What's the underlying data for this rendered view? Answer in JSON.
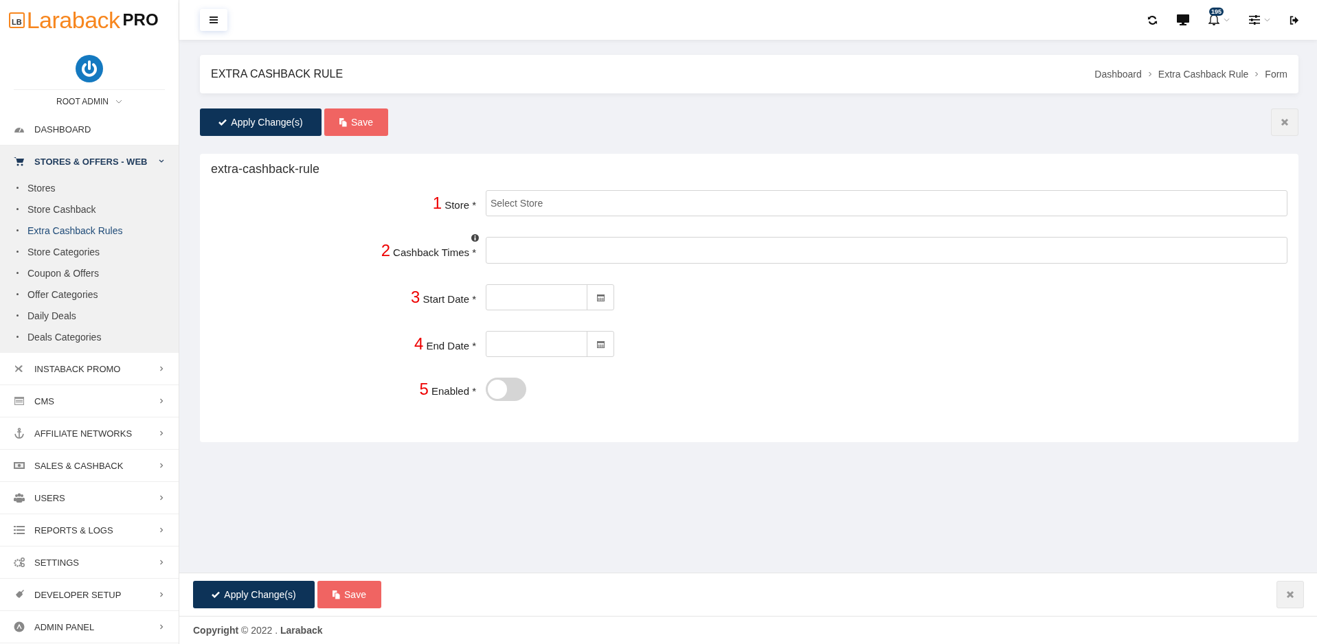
{
  "logo": {
    "mark": "LB",
    "name": "Laraback",
    "suffix": "PRO"
  },
  "user": {
    "name": "ROOT ADMIN"
  },
  "sidebar": {
    "items": [
      {
        "label": "DASHBOARD",
        "kind": "link",
        "expanded": false
      },
      {
        "label": "STORES & OFFERS - WEB",
        "kind": "group",
        "expanded": true,
        "children": [
          {
            "label": "Stores",
            "selected": false
          },
          {
            "label": "Store Cashback",
            "selected": false
          },
          {
            "label": "Extra Cashback Rules",
            "selected": true
          },
          {
            "label": "Store Categories",
            "selected": false
          },
          {
            "label": "Coupon & Offers",
            "selected": false
          },
          {
            "label": "Offer Categories",
            "selected": false
          },
          {
            "label": "Daily Deals",
            "selected": false
          },
          {
            "label": "Deals Categories",
            "selected": false
          }
        ]
      },
      {
        "label": "INSTABACK PROMO",
        "kind": "group",
        "expanded": false
      },
      {
        "label": "CMS",
        "kind": "group",
        "expanded": false
      },
      {
        "label": "AFFILIATE NETWORKS",
        "kind": "group",
        "expanded": false
      },
      {
        "label": "SALES & CASHBACK",
        "kind": "group",
        "expanded": false
      },
      {
        "label": "USERS",
        "kind": "group",
        "expanded": false
      },
      {
        "label": "REPORTS & LOGS",
        "kind": "group",
        "expanded": false
      },
      {
        "label": "SETTINGS",
        "kind": "group",
        "expanded": false
      },
      {
        "label": "DEVELOPER SETUP",
        "kind": "group",
        "expanded": false
      },
      {
        "label": "ADMIN PANEL",
        "kind": "group",
        "expanded": false
      }
    ]
  },
  "topbar": {
    "notification_count": "195"
  },
  "page": {
    "title": "EXTRA CASHBACK RULE",
    "breadcrumb": [
      "Dashboard",
      "Extra Cashback Rule",
      "Form"
    ]
  },
  "actions": {
    "apply": "Apply Change(s)",
    "save": "Save"
  },
  "form": {
    "title": "extra-cashback-rule",
    "fields": [
      {
        "marker": "1",
        "label": "Store *",
        "kind": "select",
        "placeholder": "Select Store"
      },
      {
        "marker": "2",
        "label": "Cashback Times *",
        "kind": "text",
        "info": true
      },
      {
        "marker": "3",
        "label": "Start Date *",
        "kind": "date"
      },
      {
        "marker": "4",
        "label": "End Date *",
        "kind": "date"
      },
      {
        "marker": "5",
        "label": "Enabled *",
        "kind": "toggle",
        "on": false
      }
    ]
  },
  "bottom_actions": {
    "apply": "Apply Change(s)",
    "save": "Save"
  },
  "footer": {
    "text": "**Copyright** © 2022 . **Laraback**"
  }
}
